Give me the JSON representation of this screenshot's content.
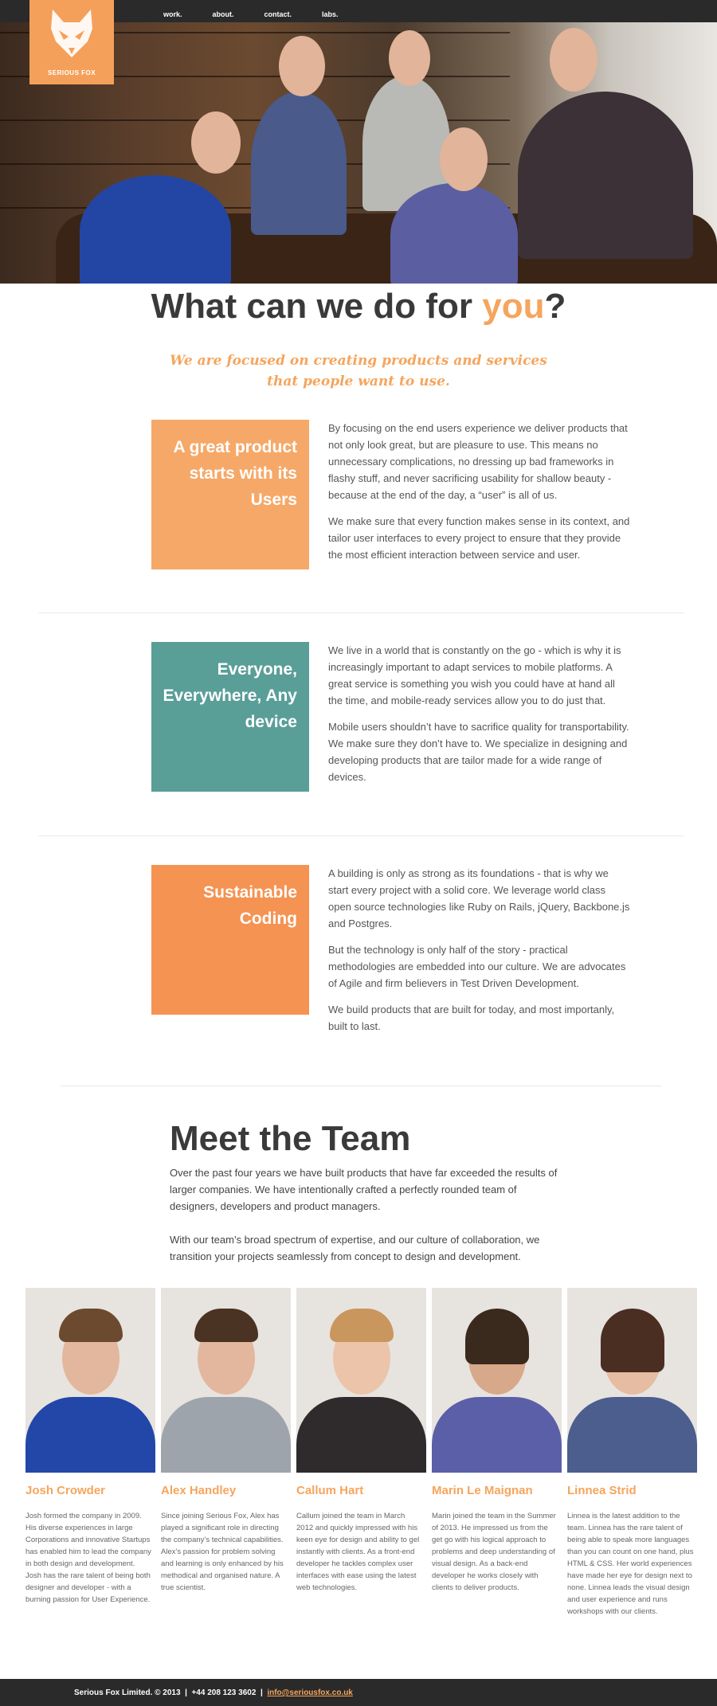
{
  "brand": {
    "name": "SERIOUS FOX"
  },
  "nav": {
    "items": [
      "work.",
      "about.",
      "contact.",
      "labs."
    ]
  },
  "headline": {
    "prefix": "What can we do for ",
    "highlight": "you",
    "suffix": "?"
  },
  "tagline": "We are focused on creating products and services that people want to use.",
  "features": [
    {
      "title": "A great product starts with its Users",
      "color": "#f6a868",
      "paragraphs": [
        "By focusing on the end users experience we deliver products that not only look great, but are pleasure to use. This means no unnecessary complications, no dressing up bad frameworks in flashy stuff, and never sacrificing usability for shallow beauty - because at the end of the day, a “user” is all of us.",
        "We make sure that every function makes sense in its context, and tailor user interfaces to every project to ensure that they provide the most efficient interaction between service and user."
      ]
    },
    {
      "title": "Everyone, Everywhere, Any device",
      "color": "#5a9e98",
      "paragraphs": [
        "We live in a world that is constantly on the go - which is why it is increasingly important to adapt services to mobile platforms. A great service is something you wish you could have at hand all the time, and mobile-ready services allow you to do just that.",
        "Mobile users shouldn’t have to sacrifice quality for transportability. We make sure they don’t have to. We specialize in designing and developing products that are tailor made for a wide range of devices."
      ]
    },
    {
      "title": "Sustainable Coding",
      "color": "#f59352",
      "paragraphs": [
        "A building is only as strong as its foundations - that is why we start every project with a solid core. We leverage world class open source technologies like Ruby on Rails, jQuery, Backbone.js and Postgres.",
        "But the technology is only half of the story - practical methodologies are embedded into our culture. We are advocates of Agile and firm believers in Test Driven Development.",
        "We build products that are built for today, and most importanly, built to last."
      ]
    }
  ],
  "team": {
    "heading": "Meet the Team",
    "intro": [
      "Over the past four years we have built products that have far exceeded the results of larger companies. We have intentionally crafted a perfectly rounded team of designers, developers and product managers.",
      "With our team’s broad spectrum of expertise, and our culture of collaboration, we transition your projects seamlessly from concept to design and development."
    ],
    "members": [
      {
        "name": "Josh Crowder",
        "bio": "Josh formed the company in 2009. His diverse experiences in large Corporations and innovative Startups has enabled him to lead the company in both design and development. Josh has the rare talent of being both designer and developer - with a burning passion for User Experience."
      },
      {
        "name": "Alex Handley",
        "bio": "Since joining Serious Fox, Alex has played a significant role in directing the company’s technical capabilities. Alex’s passion for problem solving and learning is only enhanced by his methodical and organised nature. A true scientist."
      },
      {
        "name": "Callum Hart",
        "bio": "Callum joined the team in March 2012 and quickly impressed with his keen eye for design and ability to gel instantly with clients. As a front-end developer he tackles complex user interfaces with ease using the latest web technologies."
      },
      {
        "name": "Marin Le Maignan",
        "bio": "Marin joined the team in the Summer of 2013. He impressed us from the get go with his logical approach to problems and deep understanding of visual design. As a back-end developer he works closely with clients to deliver products."
      },
      {
        "name": "Linnea Strid",
        "bio": "Linnea is the latest addition to the team. Linnea has the rare talent of being able to speak more languages than you can count on one hand, plus HTML & CSS. Her world experiences have made her eye for design next to none. Linnea leads the visual design and user experience and runs workshops with our clients."
      }
    ]
  },
  "footer": {
    "company": "Serious Fox Limited. © 2013",
    "sep": "|",
    "phone": "+44 208 123 3602",
    "email": "info@seriousfox.co.uk"
  },
  "colors": {
    "accent": "#f5a55d",
    "teal": "#5a9e98",
    "dark": "#2a2a2a"
  }
}
